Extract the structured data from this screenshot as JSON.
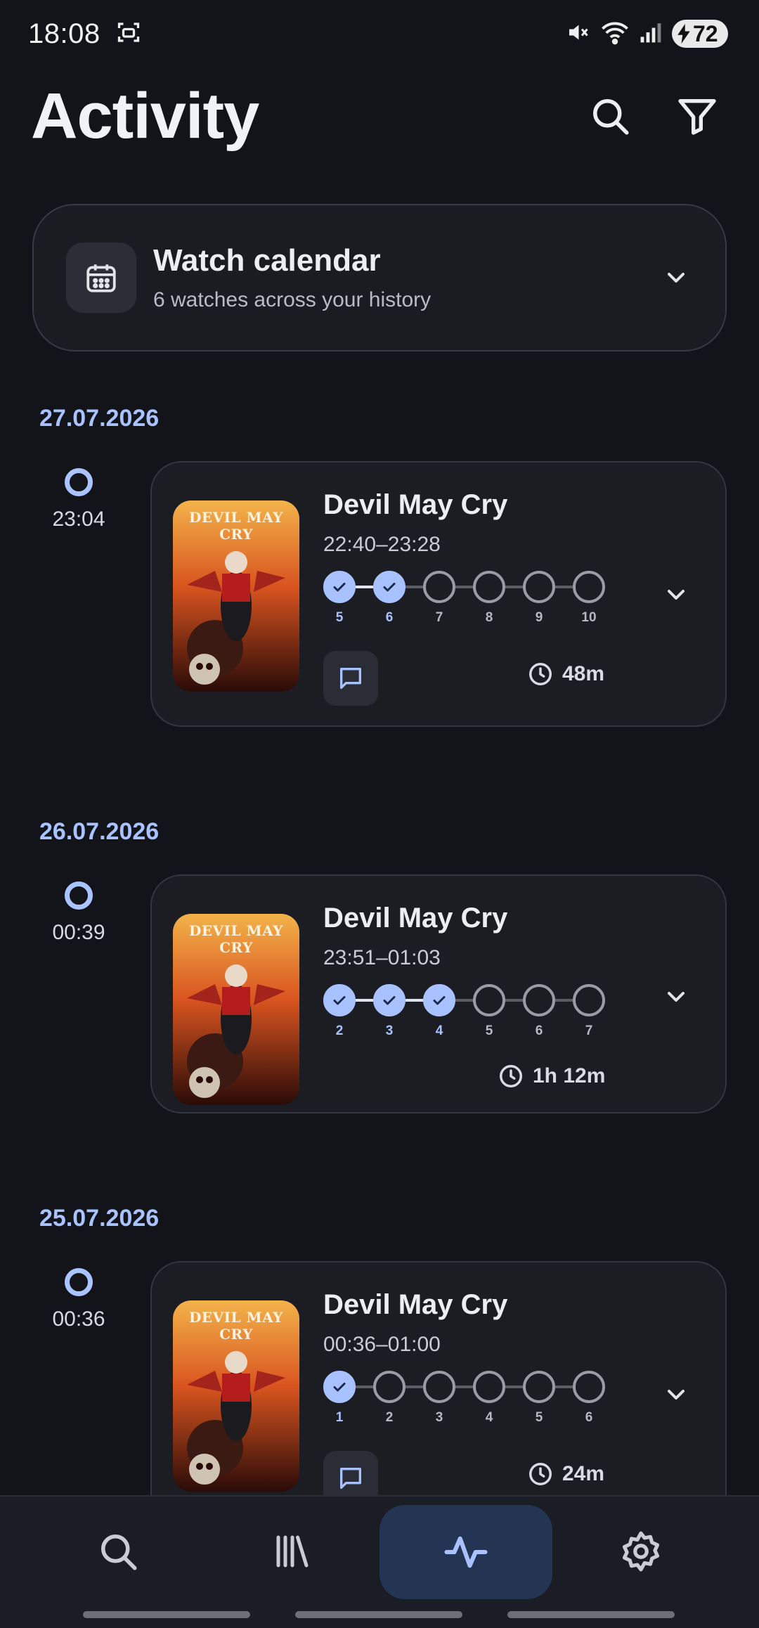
{
  "status": {
    "time": "18:08",
    "battery": "72",
    "icons": [
      "screenshot-icon",
      "mute-icon",
      "wifi-icon",
      "signal-icon",
      "charging-icon"
    ]
  },
  "header": {
    "title": "Activity",
    "actions": [
      "search-icon",
      "filter-icon"
    ]
  },
  "calendar": {
    "title": "Watch calendar",
    "subtitle": "6 watches across your history",
    "icon": "calendar-icon"
  },
  "entries": [
    {
      "date": "27.07.2026",
      "time": "23:04",
      "title": "Devil May Cry",
      "range": "22:40–23:28",
      "episodes": [
        {
          "num": "5",
          "done": true
        },
        {
          "num": "6",
          "done": true
        },
        {
          "num": "7",
          "done": false
        },
        {
          "num": "8",
          "done": false
        },
        {
          "num": "9",
          "done": false
        },
        {
          "num": "10",
          "done": false
        }
      ],
      "duration": "48m",
      "has_note": true
    },
    {
      "date": "26.07.2026",
      "time": "00:39",
      "title": "Devil May Cry",
      "range": "23:51–01:03",
      "episodes": [
        {
          "num": "2",
          "done": true
        },
        {
          "num": "3",
          "done": true
        },
        {
          "num": "4",
          "done": true
        },
        {
          "num": "5",
          "done": false
        },
        {
          "num": "6",
          "done": false
        },
        {
          "num": "7",
          "done": false
        }
      ],
      "duration": "1h 12m",
      "has_note": false
    },
    {
      "date": "25.07.2026",
      "time": "00:36",
      "title": "Devil May Cry",
      "range": "00:36–01:00",
      "episodes": [
        {
          "num": "1",
          "done": true
        },
        {
          "num": "2",
          "done": false
        },
        {
          "num": "3",
          "done": false
        },
        {
          "num": "4",
          "done": false
        },
        {
          "num": "5",
          "done": false
        },
        {
          "num": "6",
          "done": false
        }
      ],
      "duration": "24m",
      "has_note": true
    }
  ],
  "poster": {
    "logo_text": "DEVIL MAY CRY"
  },
  "nav": {
    "items": [
      "search-icon",
      "library-icon",
      "activity-icon",
      "settings-icon"
    ],
    "active": "activity-icon"
  },
  "colors": {
    "accent": "#a8c2ff",
    "background": "#12141a",
    "card": "#1b1d23",
    "nav_active": "#243453"
  }
}
